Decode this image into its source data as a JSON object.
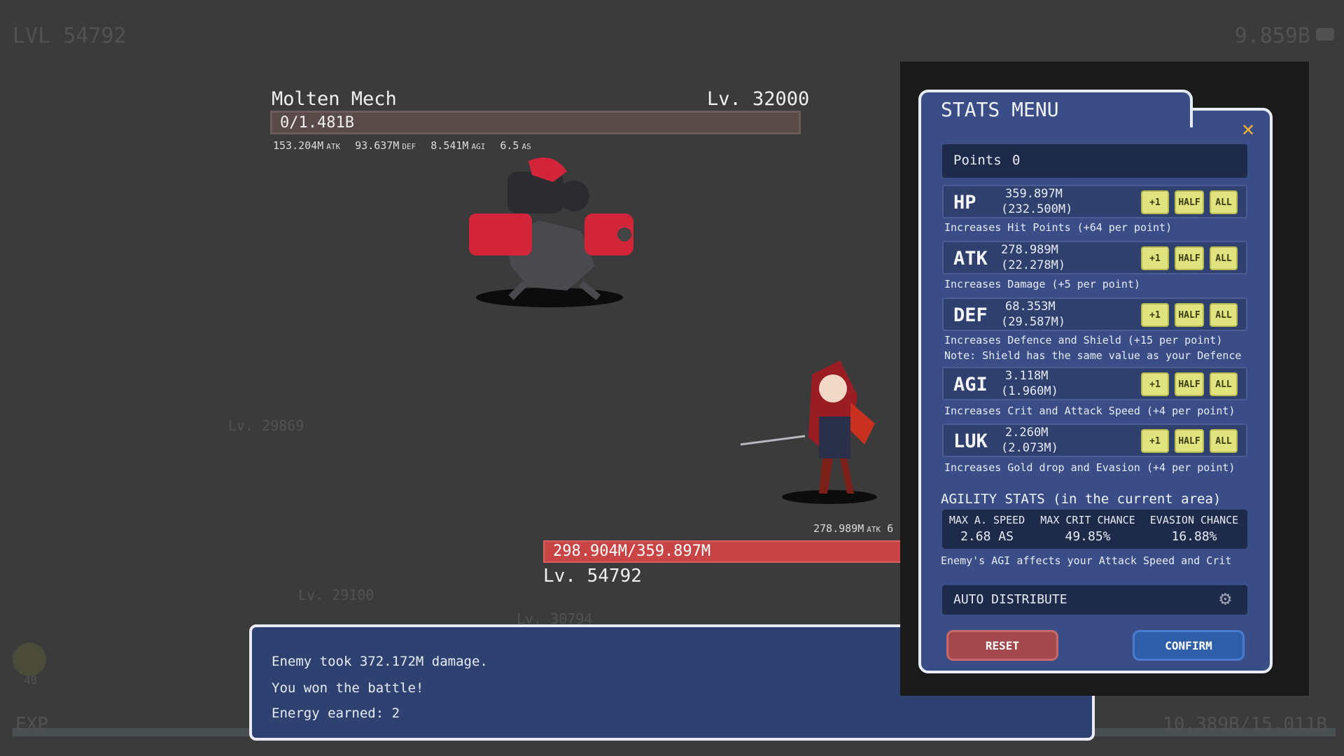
{
  "hud": {
    "level": "LVL 54792",
    "gold": "9.859B",
    "exp_label": "EXP",
    "exp_value": "10.389B/15.011B",
    "coin_count": "40"
  },
  "background_levels": [
    "Lv. 29869",
    "Lv. 29100",
    "Lv. 30794"
  ],
  "enemy": {
    "name": "Molten Mech",
    "level": "Lv. 32000",
    "hp_text": "0/1.481B",
    "hp_fraction": 0,
    "stats": [
      {
        "value": "153.204M",
        "unit": "ATK"
      },
      {
        "value": "93.637M",
        "unit": "DEF"
      },
      {
        "value": "8.541M",
        "unit": "AGI"
      },
      {
        "value": "6.5",
        "unit": "AS"
      }
    ]
  },
  "player": {
    "stats_text": "278.989M",
    "stats_unit": "ATK",
    "stats_trail": "6",
    "hp_text": "298.904M/359.897M",
    "hp_fraction": 0.83,
    "level": "Lv. 54792"
  },
  "log": {
    "lines": [
      "Enemy took 372.172M damage.",
      "You won the battle!",
      "Energy earned:  2"
    ]
  },
  "stats_menu": {
    "title": "STATS MENU",
    "close_glyph": "✕",
    "points_label": "Points",
    "points_value": "0",
    "button_labels": {
      "plus_one": "+1",
      "half": "HALF",
      "all": "ALL"
    },
    "stats": [
      {
        "name": "HP",
        "value": "359.897M",
        "base": "(232.500M)",
        "desc": "Increases Hit Points (+64 per point)"
      },
      {
        "name": "ATK",
        "value": "278.989M",
        "base": "(22.278M)",
        "desc": "Increases Damage (+5 per point)"
      },
      {
        "name": "DEF",
        "value": "68.353M",
        "base": "(29.587M)",
        "desc": "Increases Defence and Shield (+15 per point)",
        "note": "Note: Shield has the same value as your Defence"
      },
      {
        "name": "AGI",
        "value": "3.118M",
        "base": "(1.960M)",
        "desc": "Increases Crit and Attack Speed (+4 per point)"
      },
      {
        "name": "LUK",
        "value": "2.260M",
        "base": "(2.073M)",
        "desc": "Increases Gold drop and Evasion (+4 per point)"
      }
    ],
    "agility": {
      "title": "AGILITY STATS (in the current area)",
      "columns": [
        {
          "label": "MAX A. SPEED",
          "value": "2.68 AS"
        },
        {
          "label": "MAX CRIT CHANCE",
          "value": "49.85%"
        },
        {
          "label": "EVASION CHANCE",
          "value": "16.88%"
        }
      ],
      "note": "Enemy's AGI affects your Attack Speed and Crit"
    },
    "auto_distribute_label": "AUTO DISTRIBUTE",
    "reset_label": "RESET",
    "confirm_label": "CONFIRM"
  },
  "colors": {
    "panel": "#3a4d86",
    "player_hp": "#c94545",
    "button_yellow": "#e0e37e",
    "reset": "#a3494d",
    "confirm": "#2f5ea8",
    "close": "#f0b030"
  }
}
